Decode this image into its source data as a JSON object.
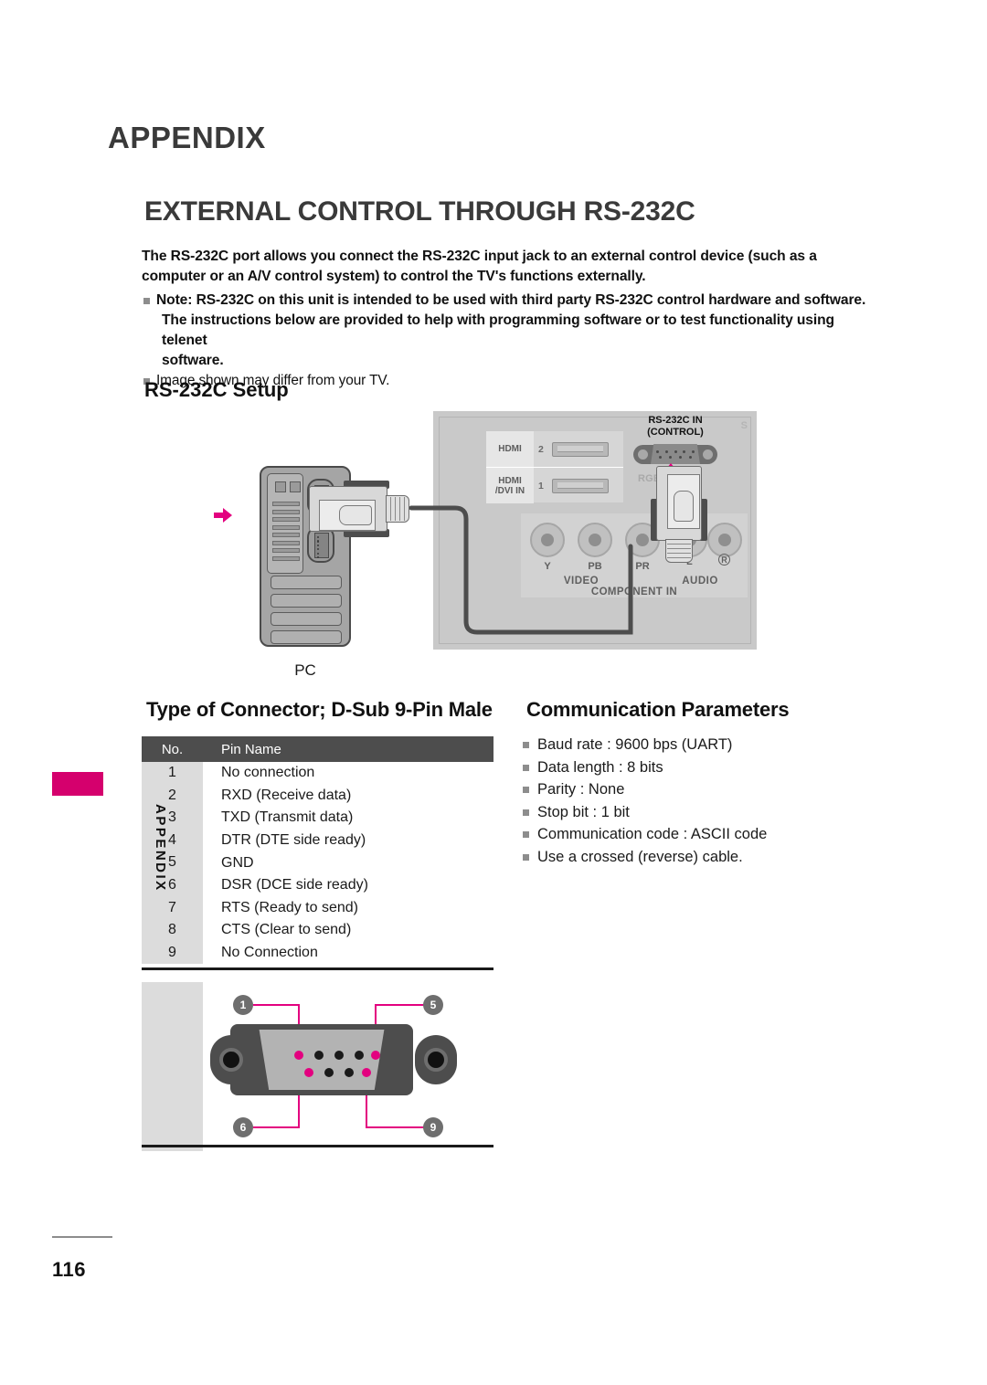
{
  "document": {
    "chapter": "APPENDIX",
    "section_title": "EXTERNAL CONTROL THROUGH RS-232C",
    "page_number": "116",
    "side_tab_label": "APPENDIX",
    "accent_color": "#d5006d"
  },
  "intro": {
    "paragraph": "The RS-232C port allows you connect the RS-232C input jack to an external control device (such as a computer or an A/V control system) to control the TV's functions externally.",
    "note_line1": "Note: RS-232C on this unit is intended to be used with third party RS-232C control hardware and software.",
    "note_line2": "The instructions below are provided to help with programming software or to test functionality using telenet",
    "note_line3": "software.",
    "image_note": "Image shown may differ from your TV."
  },
  "setup": {
    "heading": "RS-232C Setup",
    "pc_caption": "PC",
    "tv_panel": {
      "rs232_label_line1": "RS-232C IN",
      "rs232_label_line2": "(CONTROL)",
      "rgb_label": "RGB IN (PC)",
      "side_letter": "S",
      "hdmi2_label": "HDMI",
      "hdmi2_number": "2",
      "hdmi1_label_line1": "HDMI",
      "hdmi1_label_line2": "/DVI IN",
      "hdmi1_number": "1",
      "component_y": "Y",
      "component_pb": "PB",
      "component_pr": "PR",
      "video_bracket": "VIDEO",
      "audio_bracket": "AUDIO",
      "audio_left": "L",
      "audio_right": "R",
      "component_in": "COMPONENT IN"
    }
  },
  "connector": {
    "heading": "Type of Connector; D-Sub 9-Pin Male",
    "columns": [
      "No.",
      "Pin Name"
    ],
    "rows": [
      {
        "no": "1",
        "name": "No connection"
      },
      {
        "no": "2",
        "name": "RXD (Receive data)"
      },
      {
        "no": "3",
        "name": "TXD (Transmit data)"
      },
      {
        "no": "4",
        "name": "DTR (DTE side ready)"
      },
      {
        "no": "5",
        "name": "GND"
      },
      {
        "no": "6",
        "name": "DSR (DCE side ready)"
      },
      {
        "no": "7",
        "name": "RTS (Ready to send)"
      },
      {
        "no": "8",
        "name": "CTS (Clear to send)"
      },
      {
        "no": "9",
        "name": "No Connection"
      }
    ],
    "callouts": {
      "top_left": "1",
      "top_right": "5",
      "bottom_left": "6",
      "bottom_right": "9"
    }
  },
  "communication": {
    "heading": "Communication Parameters",
    "items": [
      "Baud rate : 9600 bps (UART)",
      "Data length : 8 bits",
      "Parity : None",
      "Stop bit : 1 bit",
      "Communication code : ASCII code",
      "Use a crossed (reverse) cable."
    ]
  }
}
